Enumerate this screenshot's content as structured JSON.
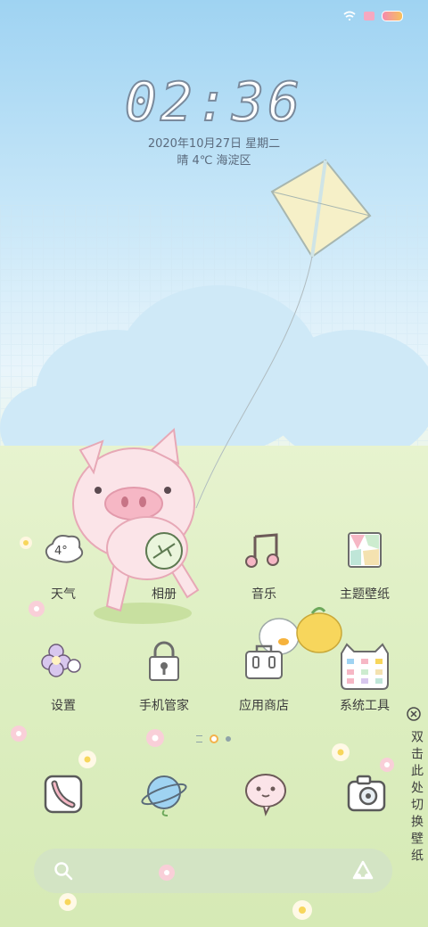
{
  "status_bar": {
    "icons": [
      "wifi-icon",
      "notification-icon"
    ]
  },
  "lock": {
    "time": "02:36",
    "date": "2020年10月27日  星期二",
    "weather": "晴  4℃  海淀区"
  },
  "apps": [
    {
      "label": "天气",
      "icon": "weather-cloud-icon",
      "temp": "4°"
    },
    {
      "label": "相册",
      "icon": "leaf-album-icon"
    },
    {
      "label": "音乐",
      "icon": "music-note-icon"
    },
    {
      "label": "主题壁纸",
      "icon": "theme-tiles-icon"
    },
    {
      "label": "设置",
      "icon": "flower-settings-icon"
    },
    {
      "label": "手机管家",
      "icon": "lock-manager-icon"
    },
    {
      "label": "应用商店",
      "icon": "bag-store-icon"
    },
    {
      "label": "系统工具",
      "icon": "cat-folder-icon"
    }
  ],
  "dock": [
    "phone-icon",
    "browser-planet-icon",
    "message-bubble-icon",
    "camera-icon"
  ],
  "search": {
    "placeholder": ""
  },
  "side_hint": {
    "text": "双击此处切换壁纸"
  },
  "colors": {
    "sky": "#9fd3f2",
    "grass": "#dbedbf",
    "pig": "#f7c8d2"
  }
}
